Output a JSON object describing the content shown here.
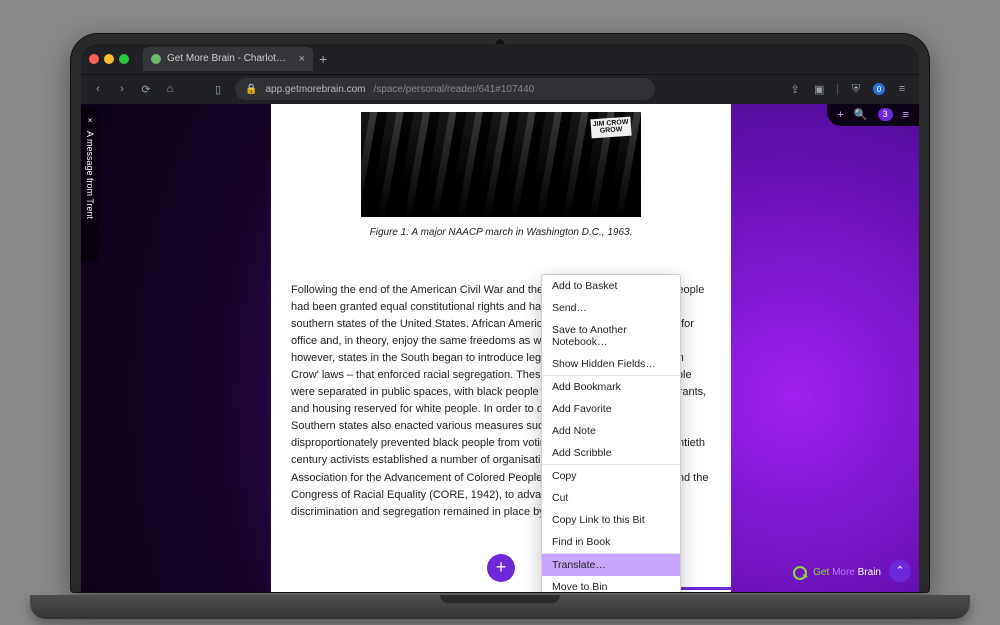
{
  "browser": {
    "tab_title": "Get More Brain - Charlottes N",
    "url_host": "app.getmorebrain.com",
    "url_path": "/space/personal/reader/641#107440",
    "indicator_count": "0"
  },
  "side_message": {
    "close": "×",
    "label": "A message from Trent"
  },
  "top_tools": {
    "badge_count": "3"
  },
  "figure": {
    "sign_line1": "JIM CROW",
    "sign_line2": "GROW",
    "caption": "Figure 1: A major NAACP march in Washington D.C., 1963."
  },
  "body": "Following the end of the American Civil War and the abolition of slavery, black people had been granted equal constitutional rights and had been permitted across the southern states of the United States. African Americans were free to vote, stand for office and, in theory, enjoy the same freedoms as white Americans. Gradually, however, states in the South began to introduce legislation – often known as 'Jim Crow' laws – that enforced racial segregation. These laws meant that black people were separated in public spaces, with black people prevented from using restaurants, and housing reserved for white people. In order to disenfranchise black people, Southern states also enacted various measures such as literacy tests, which disproportionately prevented black people from voting. In the first half of the twentieth century activists established a number of organisations, such as the National Association for the Advancement of Colored People (NAACP, formed in 1909) and the Congress of Racial Equality (CORE, 1942), to advance their rights, but racial discrimination and segregation remained in place by the 1950s.",
  "menu": {
    "items": [
      "Add to Basket",
      "Send…",
      "Save to Another Notebook…",
      "Show Hidden Fields…",
      "Add Bookmark",
      "Add Favorite",
      "Add Note",
      "Add Scribble",
      "Copy",
      "Cut",
      "Copy Link to this Bit",
      "Find in Book",
      "Translate…",
      "Move to Bin"
    ],
    "selected_index": 12
  },
  "brand": {
    "w1": "Get",
    "w2": "More",
    "w3": "Brain"
  },
  "fab_plus": "+"
}
